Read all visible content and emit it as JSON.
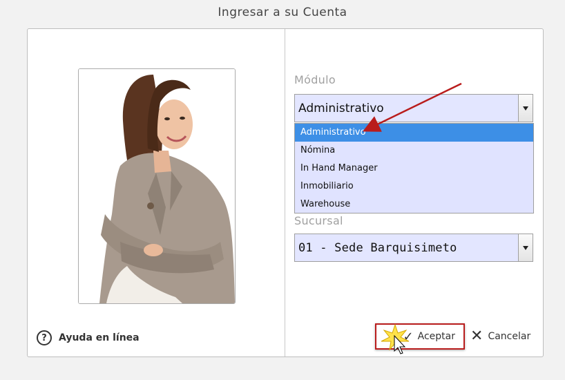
{
  "window": {
    "title": "Ingresar a su Cuenta"
  },
  "help": {
    "label": "Ayuda en línea",
    "icon": "question-circle-icon"
  },
  "modulo": {
    "label": "Módulo",
    "selected": "Administrativo",
    "options": [
      "Administrativo",
      "Nómina",
      "In Hand Manager",
      "Inmobiliario",
      "Warehouse"
    ]
  },
  "sucursal": {
    "label": "Sucursal",
    "selected": "01 - Sede Barquisimeto"
  },
  "buttons": {
    "accept": "Aceptar",
    "cancel": "Cancelar"
  },
  "colors": {
    "select_bg": "#e3e6ff",
    "highlight": "#3d8fe6",
    "annotation_red": "#b91c1c"
  }
}
